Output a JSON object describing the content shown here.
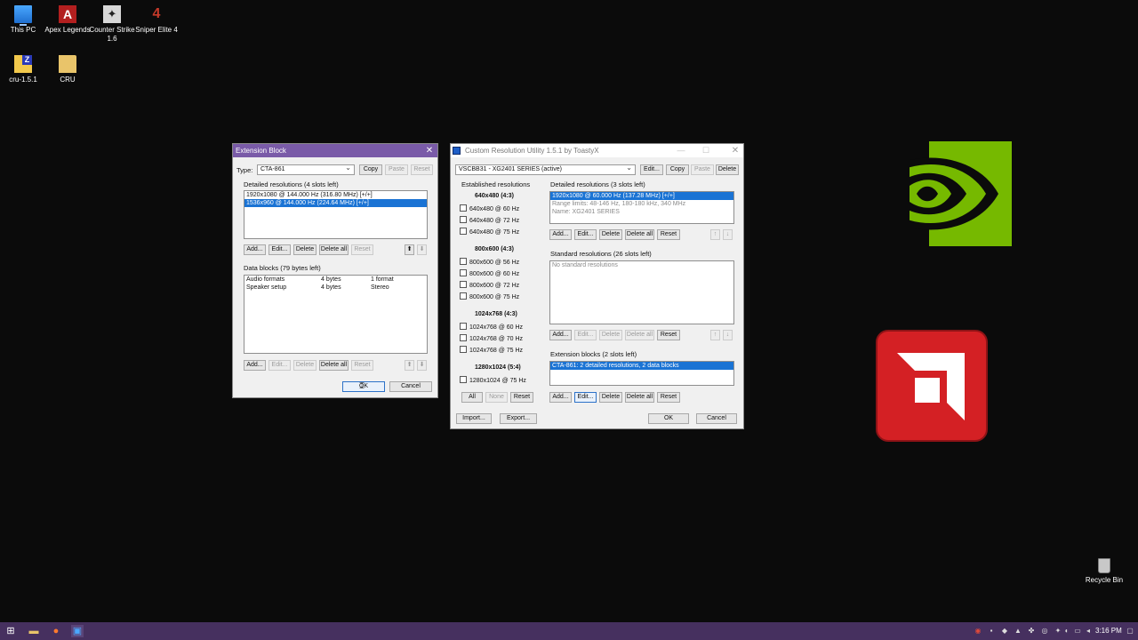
{
  "desktop": {
    "icons": [
      {
        "label": "This PC"
      },
      {
        "label": "Apex Legends"
      },
      {
        "label": "Counter Strike 1.6"
      },
      {
        "label": "Sniper Elite 4"
      },
      {
        "label": "cru-1.5.1"
      },
      {
        "label": "CRU"
      }
    ],
    "recycle_bin": "Recycle Bin"
  },
  "ext_window": {
    "title": "Extension Block",
    "type_label": "Type:",
    "type_value": "CTA-861",
    "copy": "Copy",
    "paste": "Paste",
    "reset": "Reset",
    "detailed_header": "Detailed resolutions (4 slots left)",
    "detailed": [
      "1920x1080 @ 144.000 Hz (316.80 MHz) [+/+]",
      "1536x960 @ 144.000 Hz (224.64 MHz) [+/+]"
    ],
    "add": "Add...",
    "edit": "Edit...",
    "delete": "Delete",
    "delete_all": "Delete all",
    "up": "⬆",
    "down": "⬇",
    "data_header": "Data blocks (79 bytes left)",
    "data_rows": [
      {
        "name": "Audio formats",
        "size": "4 bytes",
        "info": "1 format"
      },
      {
        "name": "Speaker setup",
        "size": "4 bytes",
        "info": "Stereo"
      }
    ],
    "ok": "OK",
    "cancel": "Cancel"
  },
  "cru_window": {
    "title": "Custom Resolution Utility 1.5.1 by ToastyX",
    "display_value": "VSCBB31 - XG2401 SERIES (active)",
    "edit": "Edit...",
    "copy": "Copy",
    "paste": "Paste",
    "delete": "Delete",
    "established_header": "Established resolutions",
    "groups": [
      {
        "head": "640x480 (4:3)",
        "items": [
          "640x480 @ 60 Hz",
          "640x480 @ 72 Hz",
          "640x480 @ 75 Hz"
        ]
      },
      {
        "head": "800x600 (4:3)",
        "items": [
          "800x600 @ 56 Hz",
          "800x600 @ 60 Hz",
          "800x600 @ 72 Hz",
          "800x600 @ 75 Hz"
        ]
      },
      {
        "head": "1024x768 (4:3)",
        "items": [
          "1024x768 @ 60 Hz",
          "1024x768 @ 70 Hz",
          "1024x768 @ 75 Hz"
        ]
      },
      {
        "head": "1280x1024 (5:4)",
        "items": [
          "1280x1024 @ 75 Hz"
        ]
      }
    ],
    "all": "All",
    "none": "None",
    "reset": "Reset",
    "detailed_header": "Detailed resolutions (3 slots left)",
    "detailed": [
      "1920x1080 @ 60.000 Hz (137.28 MHz) [+/+]",
      "Range limits: 48-146 Hz, 180-180 kHz, 340 MHz",
      "Name: XG2401 SERIES"
    ],
    "add": "Add...",
    "delete_all": "Delete all",
    "up": "↑",
    "down": "↓",
    "standard_header": "Standard resolutions (26 slots left)",
    "standard_empty": "No standard resolutions",
    "extension_header": "Extension blocks (2 slots left)",
    "extension": [
      "CTA-861: 2 detailed resolutions, 2 data blocks"
    ],
    "import": "Import...",
    "export": "Export...",
    "ok": "OK",
    "cancel": "Cancel"
  },
  "taskbar": {
    "clock": "3:16 PM"
  },
  "colors": {
    "desktop_bg": "#0b0b0b",
    "ext_title_bg": "#7a5ba8",
    "taskbar_bg": "#46305f",
    "selection": "#1a73d4",
    "nvidia_green": "#76b900",
    "amd_red": "#d42024"
  }
}
